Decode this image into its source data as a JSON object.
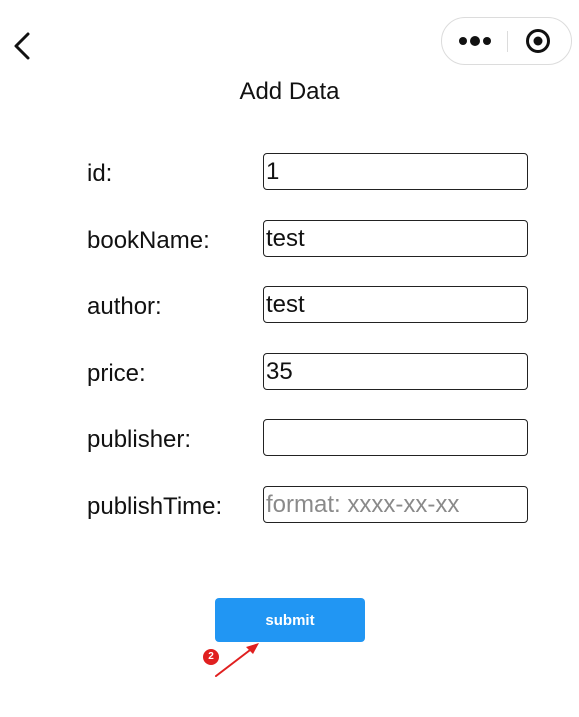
{
  "header": {
    "title": "Add Data",
    "back_icon": "chevron-left-icon",
    "more_icon": "more-dots-icon",
    "close_icon": "record-circle-icon"
  },
  "form": {
    "fields": [
      {
        "label": "id:",
        "value": "1",
        "placeholder": ""
      },
      {
        "label": "bookName:",
        "value": "test",
        "placeholder": ""
      },
      {
        "label": "author:",
        "value": "test",
        "placeholder": ""
      },
      {
        "label": "price:",
        "value": "35",
        "placeholder": ""
      },
      {
        "label": "publisher:",
        "value": "",
        "placeholder": ""
      },
      {
        "label": "publishTime:",
        "value": "",
        "placeholder": "format: xxxx-xx-xx"
      }
    ],
    "submit_label": "submit"
  },
  "annotation": {
    "badge": "2",
    "color": "#e02020"
  },
  "colors": {
    "accent": "#2196f3"
  }
}
